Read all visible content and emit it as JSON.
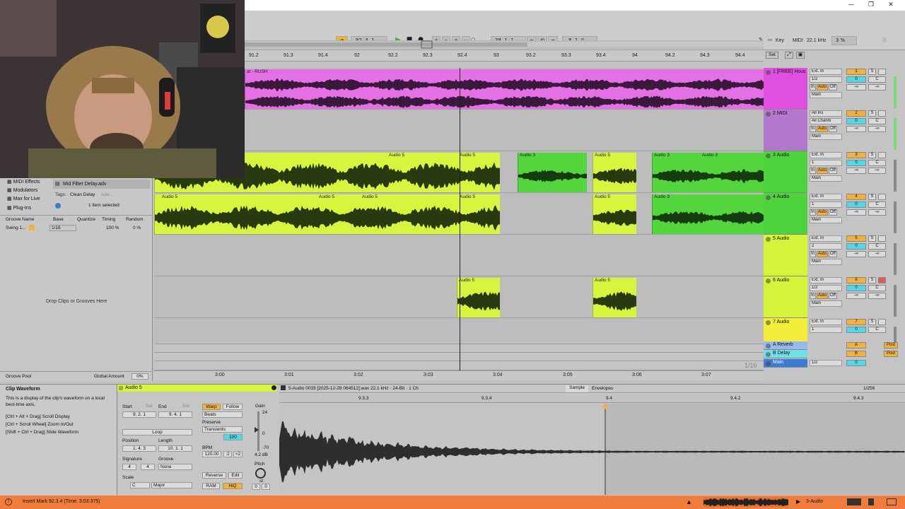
{
  "window": {
    "minimize": "—",
    "restore": "❐",
    "close": "✕"
  },
  "transport": {
    "position": "92.   4.   1",
    "loop_start": "38.   1.   1",
    "loop_length": "8.   1.   0",
    "key_label": "Key",
    "midi_label": "MIDI",
    "sample_rate": "22.1 kHz",
    "cpu": "3 %"
  },
  "ruler_labels": [
    "91.2",
    "91.3",
    "91.4",
    "92",
    "92.2",
    "92.3",
    "92.4",
    "93",
    "93.2",
    "93.3",
    "93.4",
    "94",
    "94.2",
    "94.3",
    "94.4"
  ],
  "ruler_set_label": "Set",
  "time_labels": [
    "3:00",
    "3:01",
    "3:02",
    "3:03",
    "3:04",
    "3:05",
    "3:06",
    "3:07"
  ],
  "zoom_label": "1/16",
  "browser": {
    "categories": [
      "MIDI Effects",
      "Modulators",
      "Max for Live",
      "Plug-Ins"
    ],
    "selected_file": "Mid Filter Delay.adv",
    "tags_label": "Tags:",
    "tag": "Clean Delay",
    "add_label": "Add...",
    "selection_status": "1 item selected"
  },
  "groove": {
    "headers": [
      "Groove Name",
      "Base",
      "Quantize",
      "Timing",
      "Random"
    ],
    "row": {
      "name": "Swing 1...",
      "base": "1/16",
      "timing": "100 %",
      "random": "0 %"
    },
    "drop_hint": "Drop Clips or Grooves Here",
    "pool_label": "Groove Pool",
    "global_amount_label": "Global Amount",
    "global_amount": "0%"
  },
  "tracks": [
    {
      "name": "1 [FREE] Hous",
      "color": "#e050e0",
      "input": "Ext. In",
      "channel": "1/2",
      "num": "1",
      "vol": "0",
      "pan": "C",
      "out": "Main"
    },
    {
      "name": "2 MIDI",
      "color": "#b478cf",
      "input": "All Ins",
      "channel": "All Channi",
      "num": "2",
      "vol": "0",
      "pan": "C",
      "out": "Main"
    },
    {
      "name": "3 Audio",
      "color": "#4fd33c",
      "input": "Ext. In",
      "channel": "1",
      "num": "3",
      "vol": "0",
      "pan": "C",
      "out": "Main"
    },
    {
      "name": "4 Audio",
      "color": "#4fd33c",
      "input": "Ext. In",
      "channel": "1",
      "num": "4",
      "vol": "0",
      "pan": "C",
      "out": "Main"
    },
    {
      "name": "5 Audio",
      "color": "#d4f43a",
      "input": "Ext. In",
      "channel": "2",
      "num": "5",
      "vol": "0",
      "pan": "C",
      "out": "Main"
    },
    {
      "name": "6 Audio",
      "color": "#d4f43a",
      "input": "Ext. In",
      "channel": "1/2",
      "num": "6",
      "vol": "0",
      "pan": "C",
      "out": "Main"
    },
    {
      "name": "7 Audio",
      "color": "#f2ee3a",
      "input": "Ext. In",
      "channel": "1",
      "num": "7",
      "vol": "0",
      "pan": "C",
      "out": "Main"
    }
  ],
  "returns": [
    {
      "name": "A Reverb",
      "color": "#9ab8f0",
      "letter": "A",
      "post": "Post"
    },
    {
      "name": "B Delay",
      "color": "#6fe0e8",
      "letter": "B",
      "post": "Post"
    }
  ],
  "main": {
    "name": "Main",
    "channel": "1/2",
    "vol": "0"
  },
  "monitor": {
    "in": "In",
    "auto": "Auto",
    "off": "Off"
  },
  "mute_solo": {
    "s": "S",
    "inf": "-∞"
  },
  "clips": {
    "track1_name": "at - RUSH",
    "audio5": "Audio 5",
    "audio3": "Audio 3"
  },
  "clip_info": {
    "title": "Clip Waveform",
    "desc": "This is a display of the clip's waveform on a local best-time axis.",
    "hints": [
      "[Ctrl + Alt + Drag] Scroll Display",
      "[Ctrl + Scroll Wheel] Zoom In/Out",
      "[Shift + Ctrl + Drag] Slide Waveform"
    ]
  },
  "clip_props": {
    "name": "Audio 5",
    "start_label": "Start",
    "end_label": "End",
    "set_label": "Set",
    "start": "9.   2.   1",
    "end": "9.   4.   1",
    "loop_label": "Loop",
    "position_label": "Position",
    "length_label": "Length",
    "position": "1.   4.   3",
    "length": "10.   1.   1",
    "signature_label": "Signature",
    "groove_label": "Groove",
    "sig_num": "4",
    "sig_den": "4",
    "groove_val": "None",
    "scale_label": "Scale",
    "scale_root": "C",
    "scale_mode": "Major",
    "warp_label": "Warp",
    "follow_label": "Follow",
    "beats_label": "Beats",
    "preserve_label": "Preserve",
    "transients_label": "Transients",
    "pct": "100",
    "bpm_label": "BPM",
    "bpm": "120.00",
    "half": ":2",
    "double": "×2",
    "reverse_label": "Reverse",
    "edit_label": "Edit",
    "ram_label": "RAM",
    "hiq_label": "HiQ",
    "gain_label": "Gain",
    "gain_top": "24",
    "gain_zero": "0",
    "gain_bottom": "-70",
    "gain_value": "4.2 dB",
    "pitch_label": "Pitch",
    "pitch_unit": "st",
    "pitch_a": "0",
    "pitch_b": "0"
  },
  "sample_view": {
    "file": "5-Audio 0033 [2025-12-28 064512].wav  22.1 kHz · 24-Bit · 1 Ch",
    "tab_sample": "Sample",
    "tab_envelopes": "Envelopes",
    "zoom": "1/256",
    "ruler": [
      "9.3.3",
      "9.3.4",
      "9.4",
      "9.4.2",
      "9.4.3"
    ]
  },
  "status": {
    "message": "Insert Mark 92.3.4 (Time: 3:03:375)",
    "track": "3-Audio"
  }
}
